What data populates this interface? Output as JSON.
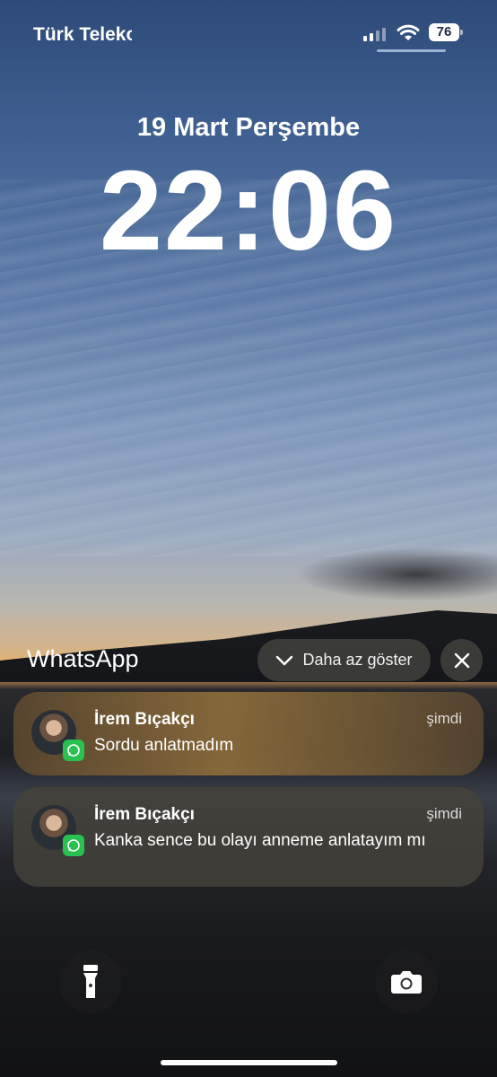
{
  "status_bar": {
    "carrier": "Türk Telekom",
    "battery": "76"
  },
  "lock_screen": {
    "date": "19 Mart Perşembe",
    "time": "22:06"
  },
  "notification_group": {
    "app_name": "WhatsApp",
    "show_less_label": "Daha az göster",
    "notifications": [
      {
        "sender": "İrem Bıçakçı",
        "time": "şimdi",
        "message": "Sordu anlatmadım"
      },
      {
        "sender": "İrem Bıçakçı",
        "time": "şimdi",
        "message": "Kanka sence bu olayı anneme anlatayım mı"
      }
    ]
  },
  "quick_actions": {
    "left_icon": "flashlight-icon",
    "right_icon": "camera-icon"
  },
  "colors": {
    "whatsapp_green": "#29c14f"
  }
}
